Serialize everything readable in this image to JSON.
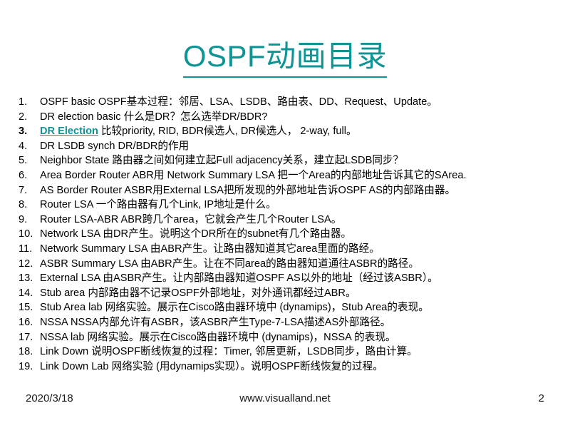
{
  "slide": {
    "title": "OSPF动画目录",
    "accent_color": "#0E9494",
    "background_color": "#FFFFFF",
    "text_color": "#000000"
  },
  "list": [
    {
      "num": "1.",
      "text": "OSPF basic    OSPF基本过程：邻居、LSA、LSDB、路由表、DD、Request、Update。"
    },
    {
      "num": "2.",
      "text": "DR election basic    什么是DR？怎么选举DR/BDR?"
    },
    {
      "num": "3.",
      "link": "DR Election",
      "text": " 比较priority, RID, BDR候选人, DR候选人， 2-way, full。",
      "bold": true
    },
    {
      "num": "4.",
      "text": "DR LSDB synch    DR/BDR的作用"
    },
    {
      "num": "5.",
      "text": "Neighbor State     路由器之间如何建立起Full adjacency关系，建立起LSDB同步？"
    },
    {
      "num": "6.",
      "text": "Area Border Router    ABR用 Network Summary LSA 把一个Area的内部地址告诉其它的SArea."
    },
    {
      "num": "7.",
      "text": "AS Border Router    ASBR用External LSA把所发现的外部地址告诉OSPF AS的内部路由器。"
    },
    {
      "num": "8.",
      "text": "Router LSA    一个路由器有几个Link, IP地址是什么。"
    },
    {
      "num": "9.",
      "text": "Router LSA-ABR    ABR跨几个area，它就会产生几个Router LSA。"
    },
    {
      "num": "10.",
      "text": "Network LSA   由DR产生。说明这个DR所在的subnet有几个路由器。"
    },
    {
      "num": "11.",
      "text": "Network Summary   LSA 由ABR产生。让路由器知道其它area里面的路经。"
    },
    {
      "num": "12.",
      "text": "ASBR Summary LSA   由ABR产生。让在不同area的路由器知道通往ASBR的路径。"
    },
    {
      "num": "13.",
      "text": "External LSA   由ASBR产生。让内部路由器知道OSPF AS以外的地址（经过该ASBR）。"
    },
    {
      "num": "14.",
      "text": "Stub area   内部路由器不记录OSPF外部地址，对外通讯都经过ABR。"
    },
    {
      "num": "15.",
      "text": "Stub Area lab   网络实验。展示在Cisco路由器环境中 (dynamips)，Stub Area的表现。"
    },
    {
      "num": "16.",
      "text": "NSSA   NSSA内部允许有ASBR，该ASBR产生Type-7-LSA描述AS外部路径。"
    },
    {
      "num": "17.",
      "text": "NSSA lab   网络实验。展示在Cisco路由器环境中 (dynamips)，NSSA 的表现。"
    },
    {
      "num": "18.",
      "text": "Link Down   说明OSPF断线恢复的过程：Timer, 邻居更新，LSDB同步，路由计算。"
    },
    {
      "num": "19.",
      "text": "Link Down Lab   网络实验 (用dynamips实现）。说明OSPF断线恢复的过程。"
    }
  ],
  "footer": {
    "date": "2020/3/18",
    "site": "www.visualland.net",
    "page_number": "2"
  }
}
